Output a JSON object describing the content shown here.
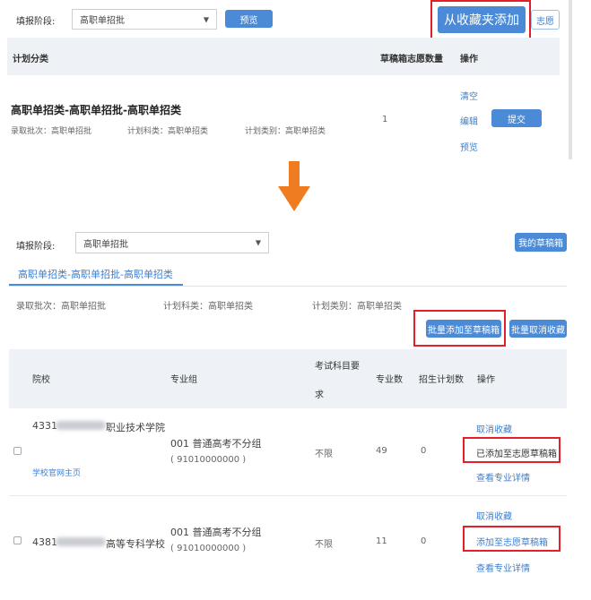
{
  "top": {
    "stage_label": "填报阶段:",
    "stage_value": "高职单招批",
    "preview_btn": "预览",
    "add_from_fav_btn": "从收藏夹添加",
    "partial_btn_text": "志愿",
    "table_headers": {
      "category": "计划分类",
      "draft_count": "草稿箱志愿数量",
      "ops": "操作"
    },
    "row": {
      "title": "高职单招类-高职单招批-高职单招类",
      "batch": "录取批次：高职单招批",
      "plan_type": "计划科类：高职单招类",
      "plan_cat": "计划类别：高职单招类",
      "count": "1",
      "clear": "清空",
      "edit": "编辑",
      "preview": "预览",
      "submit": "提交"
    }
  },
  "bottom": {
    "stage_label": "填报阶段:",
    "stage_value": "高职单招批",
    "my_draft_btn": "我的草稿箱",
    "tab_label": "高职单招类-高职单招批-高职单招类",
    "batch": "录取批次：高职单招批",
    "plan_type": "计划科类：高职单招类",
    "plan_cat": "计划类别：高职单招类",
    "batch_add_btn": "批量添加至草稿箱",
    "batch_cancel_btn": "批量取消收藏",
    "headers": {
      "school": "院校",
      "major_group": "专业组",
      "exam_req_1": "考试科目要",
      "exam_req_2": "求",
      "major_count": "专业数",
      "plan_count": "招生计划数",
      "ops": "操作"
    },
    "rows": [
      {
        "school_code": "4331",
        "school_name_suffix": "职业技术学院",
        "school_link": "学校官网主页",
        "group_name": "001 普通高考不分组",
        "group_code": "( 91010000000 )",
        "exam_req": "不限",
        "major_count": "49",
        "plan_count": "0",
        "cancel_fav": "取消收藏",
        "add_state": "已添加至志愿草稿箱",
        "view_detail": "查看专业详情"
      },
      {
        "school_code": "4381",
        "school_name_suffix": "高等专科学校",
        "group_name": "001 普通高考不分组",
        "group_code": "( 91010000000 )",
        "exam_req": "不限",
        "major_count": "11",
        "plan_count": "0",
        "cancel_fav": "取消收藏",
        "add_state": "添加至志愿草稿箱",
        "view_detail": "查看专业详情"
      }
    ]
  },
  "colors": {
    "accent": "#4a8ad6",
    "highlight": "#e2202a",
    "arrow": "#f07c22",
    "header_bg": "#eef2f6"
  }
}
